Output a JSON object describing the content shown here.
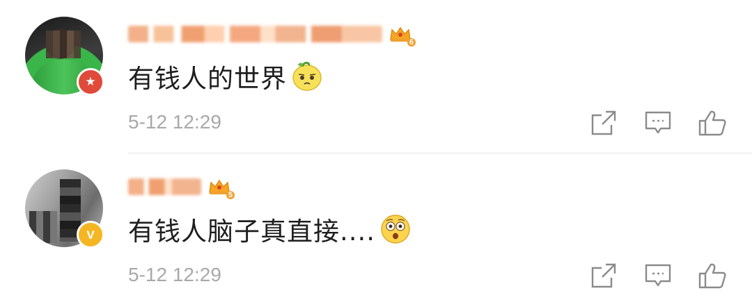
{
  "comments": [
    {
      "text": "有钱人的世界",
      "timestamp": "5-12 12:29",
      "level": "6",
      "emoji": "lemon-face-emoji",
      "avatar_badge": "red-star-badge"
    },
    {
      "text": "有钱人脑子真直接....",
      "timestamp": "5-12 12:29",
      "level": "5",
      "emoji": "shocked-face-emoji",
      "avatar_badge": "gold-v-badge"
    }
  ],
  "badges": {
    "verified_letter": "V",
    "star_glyph": "★"
  },
  "icons": {
    "share": "share-icon",
    "reply": "comment-icon",
    "like": "thumbs-up-icon"
  },
  "colors": {
    "meta": "#a8a8a8",
    "badge_red": "#e04a3a",
    "badge_gold": "#f5b623",
    "icon": "#8a8a8a"
  }
}
